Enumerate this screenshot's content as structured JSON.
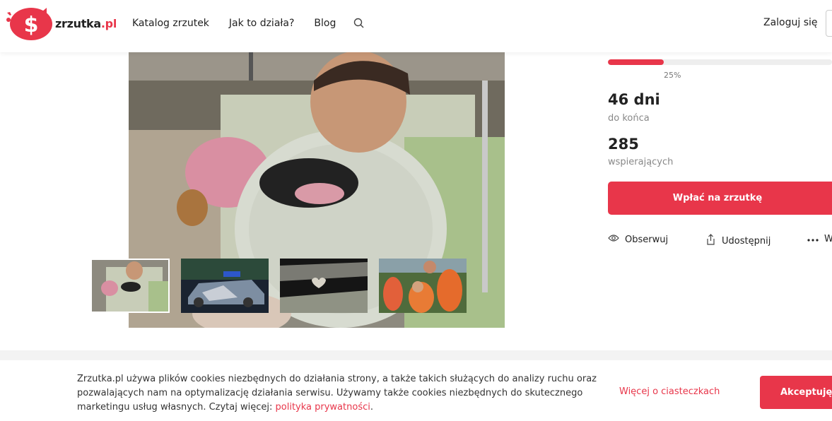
{
  "header": {
    "logo_name": "zrzutka",
    "logo_tld": ".pl",
    "nav": [
      "Katalog zrzutek",
      "Jak to działa?",
      "Blog"
    ],
    "login_label": "Zaloguj się"
  },
  "campaign": {
    "progress_percent": 25,
    "progress_label": "25%",
    "days_value": "46 dni",
    "days_label": "do końca",
    "supporters_value": "285",
    "supporters_label": "wspierających",
    "donate_label": "Wpłać na zrzutkę",
    "observe_label": "Obserwuj",
    "share_label": "Udostępnij",
    "more_label": "W"
  },
  "cookie": {
    "text": "Zrzutka.pl używa plików cookies niezbędnych do działania strony, a także takich służących do analizy ruchu oraz pozwalających nam na optymalizację działania serwisu. Używamy także cookies niezbędnych do skutecznego marketingu usług własnych. Czytaj więcej:",
    "policy_link": "polityka prywatności",
    "after_link": ".",
    "more_link": "Więcej o ciasteczkach",
    "accept_label": "Akceptuję"
  },
  "colors": {
    "brand": "#e8364a",
    "text": "#222222",
    "muted": "#888888"
  },
  "icons": [
    "search-icon",
    "eye-icon",
    "share-icon",
    "more-dots-icon"
  ]
}
